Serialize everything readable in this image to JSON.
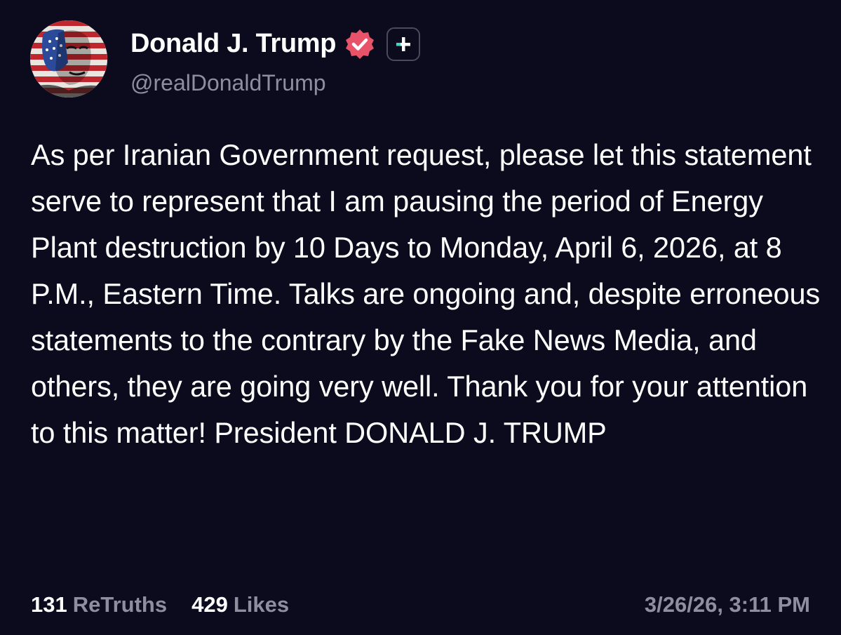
{
  "author": {
    "display_name": "Donald J. Trump",
    "handle": "@realDonaldTrump",
    "avatar_icon": "avatar-image",
    "verified_icon": "verified-badge-icon",
    "verified_color": "#e8536a",
    "plus_icon": "plus-icon",
    "plus_color": "#3fd8c4"
  },
  "post": {
    "text": "As per Iranian Government request, please let this statement serve to represent that I am pausing the period of Energy Plant destruction by 10 Days to Monday, April 6, 2026, at 8 P.M., Eastern Time. Talks are ongoing and, despite erroneous statements to the contrary by the Fake News Media, and others, they are going very well. Thank you for your attention to this matter! President DONALD J. TRUMP"
  },
  "stats": {
    "retruths_count": "131",
    "retruths_label": "ReTruths",
    "likes_count": "429",
    "likes_label": "Likes",
    "timestamp": "3/26/26, 3:11 PM"
  },
  "colors": {
    "background": "#0c0b1d",
    "text": "#ffffff",
    "muted": "#8e8ea0"
  }
}
